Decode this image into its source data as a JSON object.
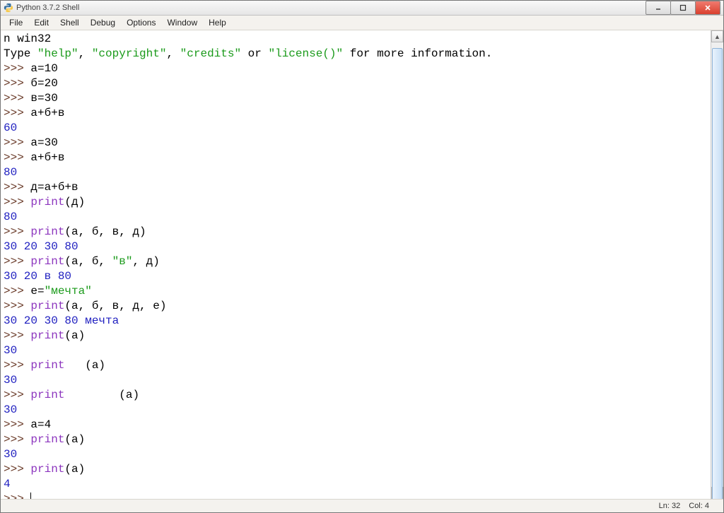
{
  "title": "Python 3.7.2 Shell",
  "menu": {
    "file": "File",
    "edit": "Edit",
    "shell": "Shell",
    "debug": "Debug",
    "options": "Options",
    "window": "Window",
    "help": "Help"
  },
  "lines": [
    {
      "parts": [
        {
          "t": "n win32",
          "cls": ""
        }
      ]
    },
    {
      "parts": [
        {
          "t": "Type ",
          "cls": ""
        },
        {
          "t": "\"help\"",
          "cls": "c-string"
        },
        {
          "t": ", ",
          "cls": ""
        },
        {
          "t": "\"copyright\"",
          "cls": "c-string"
        },
        {
          "t": ", ",
          "cls": ""
        },
        {
          "t": "\"credits\"",
          "cls": "c-string"
        },
        {
          "t": " or ",
          "cls": ""
        },
        {
          "t": "\"license()\"",
          "cls": "c-string"
        },
        {
          "t": " for more information.",
          "cls": ""
        }
      ]
    },
    {
      "parts": [
        {
          "t": ">>> ",
          "cls": "c-prompt"
        },
        {
          "t": "а=10",
          "cls": ""
        }
      ]
    },
    {
      "parts": [
        {
          "t": ">>> ",
          "cls": "c-prompt"
        },
        {
          "t": "б=20",
          "cls": ""
        }
      ]
    },
    {
      "parts": [
        {
          "t": ">>> ",
          "cls": "c-prompt"
        },
        {
          "t": "в=30",
          "cls": ""
        }
      ]
    },
    {
      "parts": [
        {
          "t": ">>> ",
          "cls": "c-prompt"
        },
        {
          "t": "а+б+в",
          "cls": ""
        }
      ]
    },
    {
      "parts": [
        {
          "t": "60",
          "cls": "c-output"
        }
      ]
    },
    {
      "parts": [
        {
          "t": ">>> ",
          "cls": "c-prompt"
        },
        {
          "t": "а=30",
          "cls": ""
        }
      ]
    },
    {
      "parts": [
        {
          "t": ">>> ",
          "cls": "c-prompt"
        },
        {
          "t": "а+б+в",
          "cls": ""
        }
      ]
    },
    {
      "parts": [
        {
          "t": "80",
          "cls": "c-output"
        }
      ]
    },
    {
      "parts": [
        {
          "t": ">>> ",
          "cls": "c-prompt"
        },
        {
          "t": "д=а+б+в",
          "cls": ""
        }
      ]
    },
    {
      "parts": [
        {
          "t": ">>> ",
          "cls": "c-prompt"
        },
        {
          "t": "print",
          "cls": "c-func"
        },
        {
          "t": "(д)",
          "cls": ""
        }
      ]
    },
    {
      "parts": [
        {
          "t": "80",
          "cls": "c-output"
        }
      ]
    },
    {
      "parts": [
        {
          "t": ">>> ",
          "cls": "c-prompt"
        },
        {
          "t": "print",
          "cls": "c-func"
        },
        {
          "t": "(а, б, в, д)",
          "cls": ""
        }
      ]
    },
    {
      "parts": [
        {
          "t": "30 20 30 80",
          "cls": "c-output"
        }
      ]
    },
    {
      "parts": [
        {
          "t": ">>> ",
          "cls": "c-prompt"
        },
        {
          "t": "print",
          "cls": "c-func"
        },
        {
          "t": "(а, б, ",
          "cls": ""
        },
        {
          "t": "\"в\"",
          "cls": "c-string"
        },
        {
          "t": ", д)",
          "cls": ""
        }
      ]
    },
    {
      "parts": [
        {
          "t": "30 20 в 80",
          "cls": "c-output"
        }
      ]
    },
    {
      "parts": [
        {
          "t": ">>> ",
          "cls": "c-prompt"
        },
        {
          "t": "е=",
          "cls": ""
        },
        {
          "t": "\"мечта\"",
          "cls": "c-string"
        }
      ]
    },
    {
      "parts": [
        {
          "t": ">>> ",
          "cls": "c-prompt"
        },
        {
          "t": "print",
          "cls": "c-func"
        },
        {
          "t": "(а, б, в, д, е)",
          "cls": ""
        }
      ]
    },
    {
      "parts": [
        {
          "t": "30 20 30 80 мечта",
          "cls": "c-output"
        }
      ]
    },
    {
      "parts": [
        {
          "t": ">>> ",
          "cls": "c-prompt"
        },
        {
          "t": "print",
          "cls": "c-func"
        },
        {
          "t": "(а)",
          "cls": ""
        }
      ]
    },
    {
      "parts": [
        {
          "t": "30",
          "cls": "c-output"
        }
      ]
    },
    {
      "parts": [
        {
          "t": ">>> ",
          "cls": "c-prompt"
        },
        {
          "t": "print",
          "cls": "c-func"
        },
        {
          "t": "   (а)",
          "cls": ""
        }
      ]
    },
    {
      "parts": [
        {
          "t": "30",
          "cls": "c-output"
        }
      ]
    },
    {
      "parts": [
        {
          "t": ">>> ",
          "cls": "c-prompt"
        },
        {
          "t": "print",
          "cls": "c-func"
        },
        {
          "t": "        (а)",
          "cls": ""
        }
      ]
    },
    {
      "parts": [
        {
          "t": "30",
          "cls": "c-output"
        }
      ]
    },
    {
      "parts": [
        {
          "t": ">>> ",
          "cls": "c-prompt"
        },
        {
          "t": "а=4",
          "cls": ""
        }
      ]
    },
    {
      "parts": [
        {
          "t": ">>> ",
          "cls": "c-prompt"
        },
        {
          "t": "print",
          "cls": "c-func"
        },
        {
          "t": "(а)",
          "cls": ""
        }
      ]
    },
    {
      "parts": [
        {
          "t": "30",
          "cls": "c-output"
        }
      ]
    },
    {
      "parts": [
        {
          "t": ">>> ",
          "cls": "c-prompt"
        },
        {
          "t": "print",
          "cls": "c-func"
        },
        {
          "t": "(а)",
          "cls": ""
        }
      ]
    },
    {
      "parts": [
        {
          "t": "4",
          "cls": "c-output"
        }
      ]
    },
    {
      "parts": [
        {
          "t": ">>> ",
          "cls": "c-prompt"
        }
      ],
      "cursor": true
    }
  ],
  "status": {
    "line": "Ln: 32",
    "col": "Col: 4"
  }
}
